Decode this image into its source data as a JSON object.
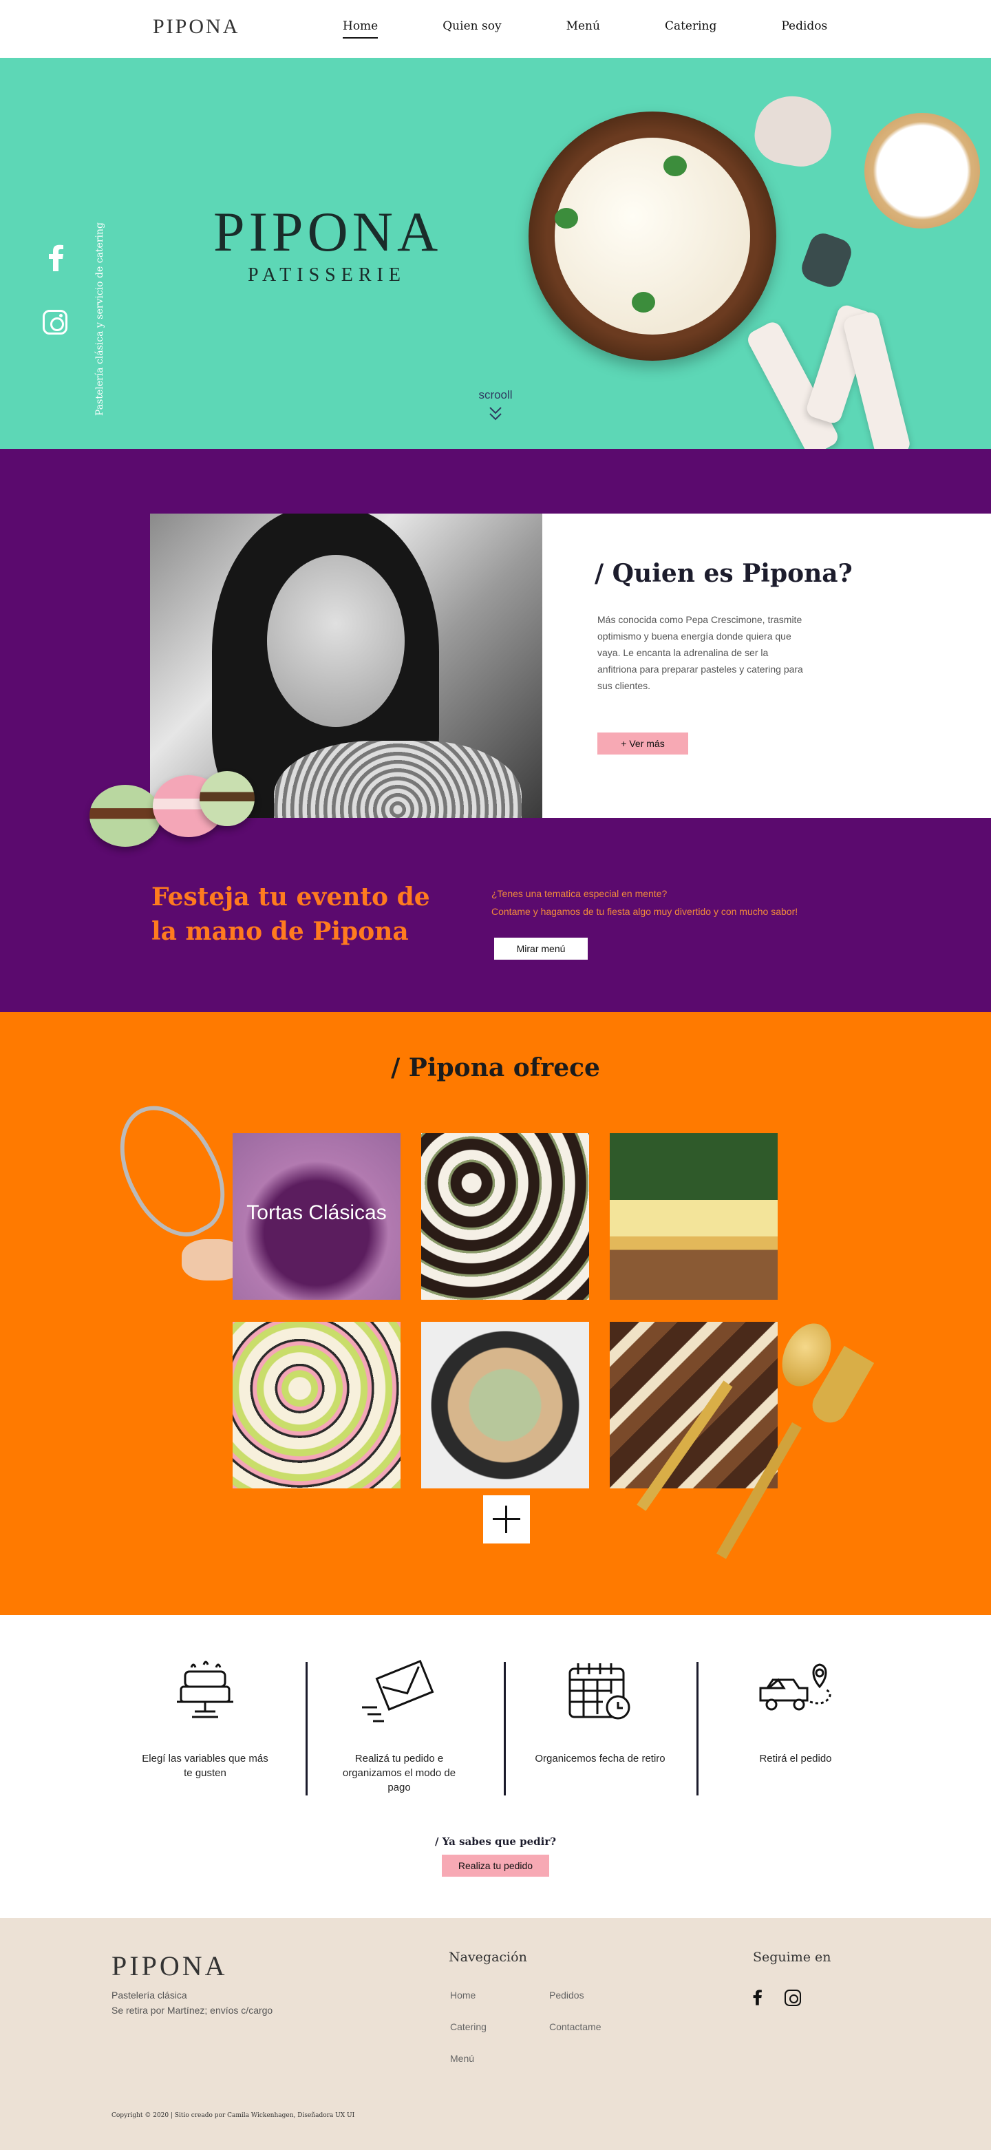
{
  "nav": {
    "logo": "PIPONA",
    "links": [
      "Home",
      "Quien soy",
      "Menú",
      "Catering",
      "Pedidos"
    ]
  },
  "hero": {
    "vertical_text": "Pastelería clásica y servicio de catering",
    "brand_title": "PIPONA",
    "brand_sub": "PATISSERIE",
    "scroll": "scrooll",
    "social_icons": [
      "facebook-icon",
      "instagram-icon"
    ],
    "bg_color": "#5dd7b6"
  },
  "about": {
    "title": "/ Quien es Pipona?",
    "description": "Más conocida como Pepa Crescimone, trasmite optimismo y buena energía donde quiera que vaya.  Le encanta la adrenalina de ser la anfitriona para preparar pasteles y catering para sus clientes.",
    "more_button": "+ Ver más",
    "bg_color": "#5b0a6e"
  },
  "event": {
    "headline": "Festeja tu evento de la mano de Pipona",
    "question": "¿Tenes una tematica especial en mente?",
    "cta_text": "Contame y hagamos de tu fiesta algo muy divertido y con mucho sabor!",
    "button": "Mirar menú"
  },
  "offers": {
    "title": "/ Pipona ofrece",
    "tiles": [
      {
        "label": "Tortas Clásicas"
      },
      {
        "label": ""
      },
      {
        "label": ""
      },
      {
        "label": ""
      },
      {
        "label": ""
      },
      {
        "label": ""
      }
    ],
    "bg_color": "#ff7a00"
  },
  "steps": {
    "items": [
      {
        "icon": "cake-icon",
        "text": "Elegí las variables que más te gusten"
      },
      {
        "icon": "envelope-icon",
        "text": "Realizá tu pedido e organizamos el modo de pago"
      },
      {
        "icon": "calendar-icon",
        "text": "Organicemos fecha de retiro"
      },
      {
        "icon": "delivery-location-icon",
        "text": "Retirá el pedido"
      }
    ],
    "prompt": "/ Ya sabes que pedir?",
    "button": "Realiza tu pedido"
  },
  "footer": {
    "logo": "PIPONA",
    "line1": "Pastelería clásica",
    "line2": "Se retira por Martínez; envíos c/cargo",
    "nav_heading": "Navegación",
    "nav_links": [
      "Home",
      "Pedidos",
      "Catering",
      "Contactame",
      "Menú"
    ],
    "follow_heading": "Seguime en",
    "copyright": "Copyright © 2020 | Sitio creado por Camila Wickenhagen, Diseñadora UX UI",
    "bg_color": "#ece1d5"
  }
}
